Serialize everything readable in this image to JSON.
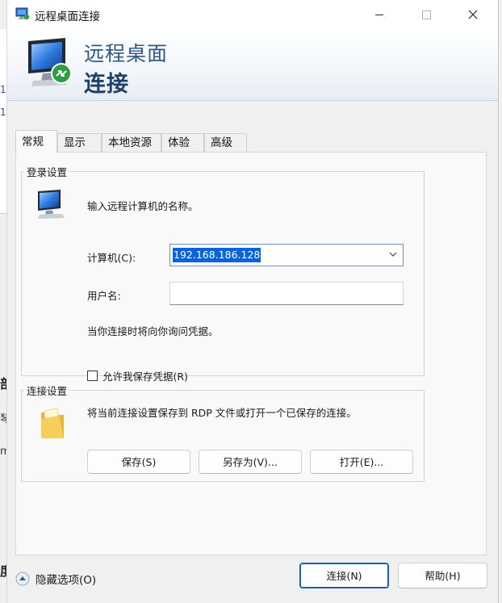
{
  "window": {
    "title": "远程桌面连接"
  },
  "banner": {
    "line1": "远程桌面",
    "line2": "连接"
  },
  "tabs": [
    {
      "label": "常规",
      "active": true
    },
    {
      "label": "显示",
      "active": false
    },
    {
      "label": "本地资源",
      "active": false
    },
    {
      "label": "体验",
      "active": false
    },
    {
      "label": "高级",
      "active": false
    }
  ],
  "login": {
    "group_label": "登录设置",
    "intro": "输入远程计算机的名称。",
    "computer_label": "计算机(C):",
    "computer_value": "192.168.186.128",
    "username_label": "用户名:",
    "username_value": "",
    "note": "当你连接时将向你询问凭据。",
    "save_credentials_label": "允许我保存凭据(R)",
    "save_credentials_checked": false
  },
  "connection": {
    "group_label": "连接设置",
    "description": "将当前连接设置保存到 RDP 文件或打开一个已保存的连接。",
    "save_label": "保存(S)",
    "save_as_label": "另存为(V)...",
    "open_label": "打开(E)..."
  },
  "footer": {
    "hide_options_label": "隐藏选项(O)",
    "connect_label": "连接(N)",
    "help_label": "帮助(H)"
  },
  "background": {
    "glyph1": "部",
    "glyph2": "琴",
    "glyph3": "m",
    "glyph4": "度"
  },
  "colors": {
    "accent": "#0a64d8",
    "banner_title": "#1f4066",
    "primary_border": "#1b5db8"
  }
}
